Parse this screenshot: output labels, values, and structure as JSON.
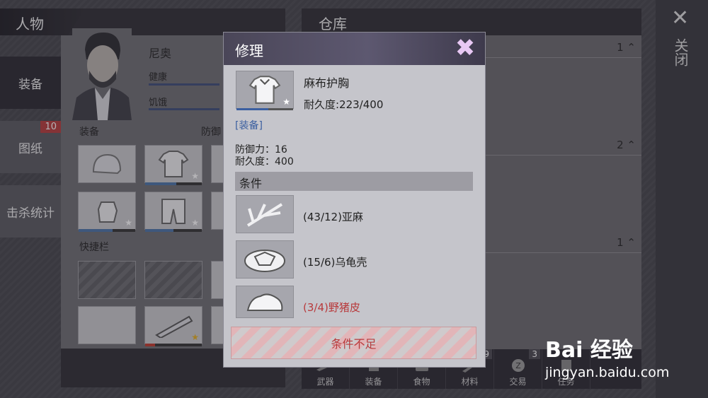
{
  "left_panel": {
    "title": "人物",
    "tabs": [
      {
        "label": "装备",
        "active": true
      },
      {
        "label": "图纸",
        "badge": "10"
      },
      {
        "label": "击杀统计"
      }
    ],
    "character": {
      "name": "尼奥",
      "stats": [
        {
          "label": "健康"
        },
        {
          "label": "饥饿"
        }
      ]
    },
    "sections": {
      "equipment": "装备",
      "defense": "防御",
      "quickbar": "快捷栏"
    }
  },
  "right_panel": {
    "title": "仓库",
    "rows": [
      {
        "count": "1"
      },
      {
        "count": "2"
      },
      {
        "count": "1"
      }
    ],
    "bottom_tabs": [
      {
        "label": "武器"
      },
      {
        "label": "装备"
      },
      {
        "label": "食物"
      },
      {
        "label": "材料",
        "badge": "9"
      },
      {
        "label": "交易",
        "badge": "3"
      },
      {
        "label": "任务"
      }
    ]
  },
  "close": {
    "label": "关闭"
  },
  "modal": {
    "title": "修理",
    "item": {
      "name": "麻布护胸",
      "durability": "耐久度:223/400",
      "category": "[装备]",
      "defense": "防御力：16",
      "max_durability": "耐久度：400"
    },
    "conditions_title": "条件",
    "conditions": [
      {
        "text": "(43/12)亚麻",
        "met": true
      },
      {
        "text": "(15/6)乌龟壳",
        "met": true
      },
      {
        "text": "(3/4)野猪皮",
        "met": false
      }
    ],
    "action_label": "条件不足"
  },
  "colors": {
    "warning": "#b8393b",
    "accent": "#3b5fa0"
  },
  "watermark": {
    "logo": "Bai 经验",
    "url": "jingyan.baidu.com"
  }
}
